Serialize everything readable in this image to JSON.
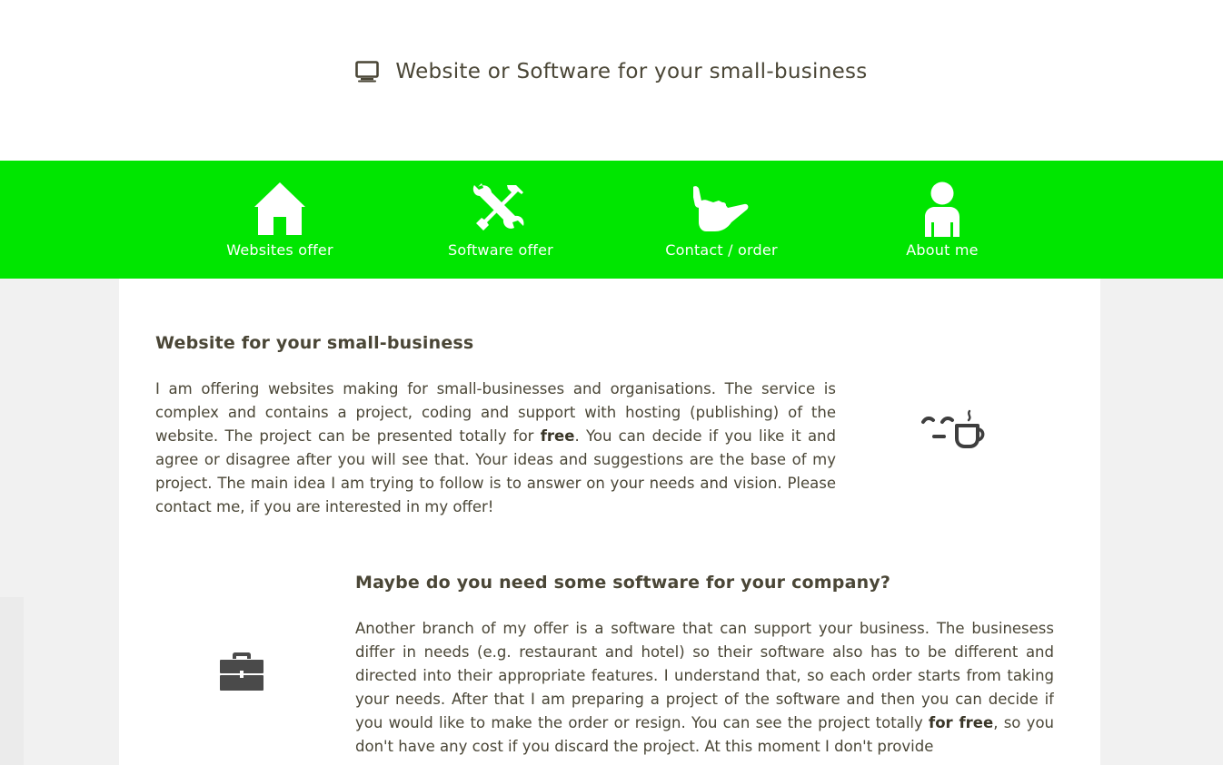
{
  "header": {
    "icon": "monitor-icon",
    "title": "Website or Software for your small-business"
  },
  "nav": {
    "background_color": "#00e600",
    "items": [
      {
        "icon": "home-icon",
        "label": "Websites offer"
      },
      {
        "icon": "tools-icon",
        "label": "Software offer"
      },
      {
        "icon": "shaka-hand-icon",
        "label": "Contact / order"
      },
      {
        "icon": "user-icon",
        "label": "About me"
      }
    ]
  },
  "sections": {
    "websites": {
      "heading": "Website for your small-business",
      "text_before_bold": "I am offering websites making for small-businesses and organisations. The service is complex and contains a project, coding and support with hosting (publishing) of the website. The project can be presented totally for ",
      "bold": "free",
      "text_after_bold": ". You can decide if you like it and agree or disagree after you will see that. Your ideas and suggestions are the base of my project. The main idea I am trying to follow is to answer on your needs and vision. Please contact me, if you are interested in my offer!",
      "icon": "coffee-icon"
    },
    "software": {
      "heading": "Maybe do you need some software for your company?",
      "text_before_bold": "Another branch of my offer is a software that can support your business. The businesess differ in needs (e.g. restaurant and hotel) so their software also has to be different and directed into their appropriate features. I understand that, so each order starts from taking your needs. After that I am preparing a project of the software and then you can decide if you would like to make the order or resign. You can see the project totally ",
      "bold": "for free",
      "text_after_bold": ", so you don't have any cost if you discard the project. At this moment I don't provide",
      "icon": "briefcase-icon"
    }
  }
}
